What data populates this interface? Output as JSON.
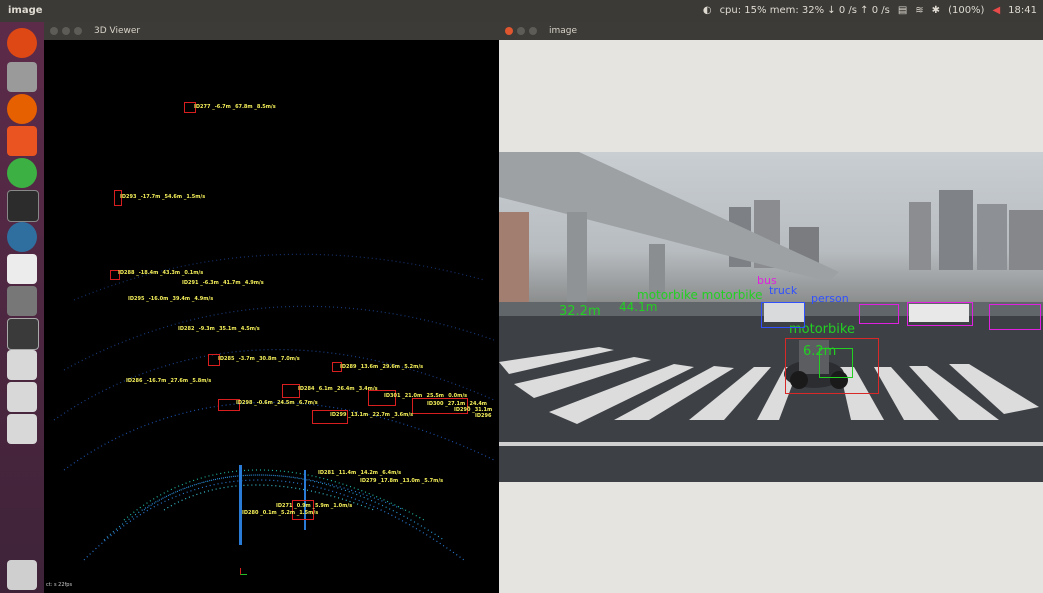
{
  "topbar": {
    "app_name": "image",
    "status": "cpu: 15% mem: 32%   ↓ 0 /s ↑ 0 /s",
    "battery": "(100%)",
    "time": "18:41"
  },
  "viewer": {
    "title": "3D Viewer",
    "footer": "ct: s 22fps",
    "labels": [
      "ID277 _-6.7m _67.8m _8.5m/s",
      "ID293 _-17.7m _54.6m _1.5m/s",
      "ID288 _-18.4m _43.3m _0.1m/s",
      "ID291 _-6.3m _41.7m _4.9m/s",
      "ID295 _-16.0m _39.4m _4.9m/s",
      "ID282 _-9.3m _35.1m _4.5m/s",
      "ID285 _-3.7m _30.8m _7.0m/s",
      "ID289 _13.6m _29.6m _5.2m/s",
      "ID286 _-16.7m _27.6m _5.8m/s",
      "ID284 _6.1m _26.4m _3.4m/s",
      "ID301 _21.0m _25.5m _0.0m/s",
      "ID298 _-0.6m _24.5m _6.7m/s",
      "ID300 _27.1m _24.4m",
      "ID290 _31.1m",
      "ID296",
      "ID299 _13.1m _22.7m _3.6m/s",
      "ID281 _11.4m _14.2m _6.4m/s",
      "ID279 _17.8m _13.0m _5.7m/s",
      "ID271 _0.9m _5.9m _1.0m/s",
      "ID280 _0.1m _5.2m _1.5m/s"
    ]
  },
  "image": {
    "title": "image",
    "detections": {
      "bus": "bus",
      "truck": "truck",
      "person": "person",
      "motorbike_main": "motorbike",
      "dist_main": "6.2m",
      "dist_left": "32.2m",
      "dist_mid": "44.1m",
      "cluster": "motorbike motorbike"
    }
  },
  "colors": {
    "launcher": "#5d2b4a",
    "lidar_box": "#d81e1e",
    "lidar_label": "#f5f05a",
    "det_red": "#d82828",
    "det_green": "#22d022",
    "det_magenta": "#e020e0",
    "det_blue": "#3050ff"
  }
}
